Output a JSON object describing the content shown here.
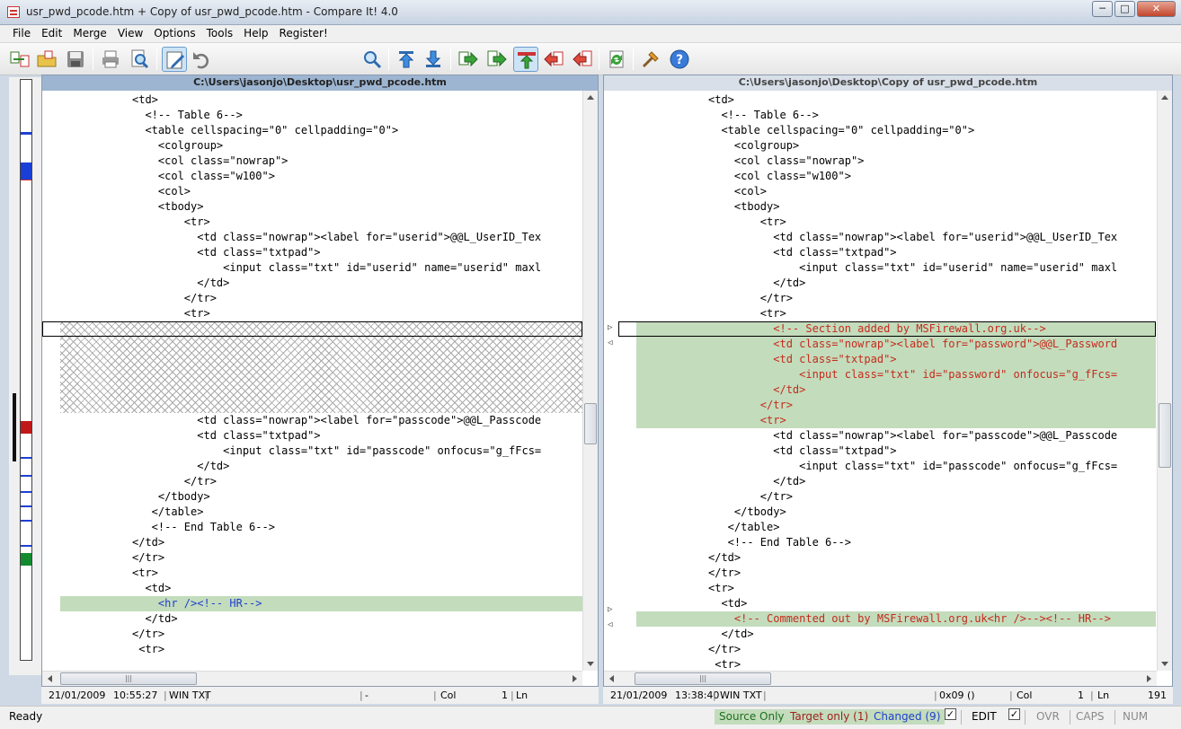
{
  "window": {
    "title": "usr_pwd_pcode.htm + Copy of usr_pwd_pcode.htm - Compare It! 4.0",
    "minimize": "─",
    "maximize": "□",
    "close": "✕"
  },
  "menu": [
    "File",
    "Edit",
    "Merge",
    "View",
    "Options",
    "Tools",
    "Help",
    "Register!"
  ],
  "toolbar": {
    "icons": [
      "open-files-icon",
      "open-folder-icon",
      "save-icon",
      "print-icon",
      "print-preview-icon",
      "edit-mode-icon",
      "undo-icon",
      "search-combo",
      "find-icon",
      "previous-difference-icon",
      "next-difference-icon",
      "copy-right-icon",
      "copy-right-all-icon",
      "sync-scroll-icon",
      "copy-left-icon",
      "copy-left-all-icon",
      "refresh-icon",
      "settings-icon",
      "help-icon"
    ],
    "search_value": ""
  },
  "colors": {
    "changed": "#c3dcbc",
    "added_text": "#c42b1c",
    "tag_text": "#1f3fcf",
    "left_header": "#9db5d1"
  },
  "left": {
    "path": "C:\\Users\\jasonjo\\Desktop\\usr_pwd_pcode.htm",
    "status": {
      "date": "21/01/2009",
      "time": "10:55:27",
      "format": "WIN TXT",
      "code": "-",
      "col_label": "Col",
      "col": "1",
      "ln_label": "Ln",
      "ln": ""
    }
  },
  "right": {
    "path": "C:\\Users\\jasonjo\\Desktop\\Copy of usr_pwd_pcode.htm",
    "status": {
      "date": "21/01/2009",
      "time": "13:38:40",
      "format": "WIN TXT",
      "code": "0x09 ()",
      "col_label": "Col",
      "col": "1",
      "ln_label": "Ln",
      "ln": "191"
    }
  },
  "code": {
    "left_lines": [
      "<td>",
      "  <!-- Table 6-->",
      "  <table cellspacing=\"0\" cellpadding=\"0\">",
      "    <colgroup>",
      "    <col class=\"nowrap\">",
      "    <col class=\"w100\">",
      "    <col>",
      "    <tbody>",
      "        <tr>",
      "          <td class=\"nowrap\"><label for=\"userid\">@@L_UserID_Tex",
      "          <td class=\"txtpad\">",
      "              <input class=\"txt\" id=\"userid\" name=\"userid\" maxl",
      "          </td>",
      "        </tr>",
      "        <tr>",
      "",
      "",
      "",
      "",
      "",
      "",
      "          <td class=\"nowrap\"><label for=\"passcode\">@@L_Passcode",
      "          <td class=\"txtpad\">",
      "              <input class=\"txt\" id=\"passcode\" onfocus=\"g_fFcs=",
      "          </td>",
      "        </tr>",
      "    </tbody>",
      "   </table>",
      "   <!-- End Table 6-->",
      "</td>",
      "</tr>",
      "<tr>",
      "  <td>",
      "    <hr /><!-- HR-->",
      "  </td>",
      "</tr>",
      " <tr>"
    ],
    "right_lines": [
      "<td>",
      "  <!-- Table 6-->",
      "  <table cellspacing=\"0\" cellpadding=\"0\">",
      "    <colgroup>",
      "    <col class=\"nowrap\">",
      "    <col class=\"w100\">",
      "    <col>",
      "    <tbody>",
      "        <tr>",
      "          <td class=\"nowrap\"><label for=\"userid\">@@L_UserID_Tex",
      "          <td class=\"txtpad\">",
      "              <input class=\"txt\" id=\"userid\" name=\"userid\" maxl",
      "          </td>",
      "        </tr>",
      "        <tr>",
      "          <!-- Section added by MSFirewall.org.uk-->",
      "          <td class=\"nowrap\"><label for=\"password\">@@L_Password",
      "          <td class=\"txtpad\">",
      "              <input class=\"txt\" id=\"password\" onfocus=\"g_fFcs=",
      "          </td>",
      "        </tr>",
      "        <tr>",
      "          <td class=\"nowrap\"><label for=\"passcode\">@@L_Passcode",
      "          <td class=\"txtpad\">",
      "              <input class=\"txt\" id=\"passcode\" onfocus=\"g_fFcs=",
      "          </td>",
      "        </tr>",
      "    </tbody>",
      "   </table>",
      "   <!-- End Table 6-->",
      "</td>",
      "</tr>",
      "<tr>",
      "  <td>",
      "    <!-- Commented out by MSFirewall.org.uk<hr />--><!-- HR-->",
      "  </td>",
      "</tr>",
      " <tr>"
    ]
  },
  "statusbar": {
    "ready": "Ready",
    "source_only": "Source Only",
    "target_only": "Target only (1)",
    "changed": "Changed (9)",
    "edit": "EDIT",
    "ovr": "OVR",
    "caps": "CAPS",
    "num": "NUM"
  }
}
